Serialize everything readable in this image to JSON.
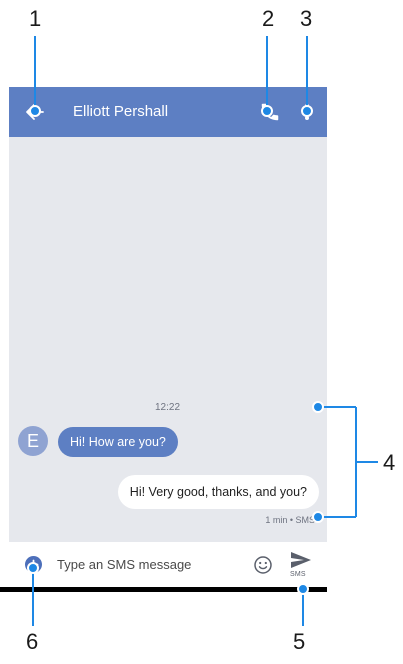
{
  "callouts": {
    "n1": "1",
    "n2": "2",
    "n3": "3",
    "n4": "4",
    "n5": "5",
    "n6": "6"
  },
  "appbar": {
    "back_icon": "arrow-left-icon",
    "title": "Elliott Pershall",
    "call_icon": "phone-icon",
    "menu_icon": "more-vert-icon",
    "color": "#5d7fc3"
  },
  "conversation": {
    "timestamp": "12:22",
    "contact_initial": "E",
    "incoming_message": "Hi! How are you?",
    "outgoing_message": "Hi! Very good, thanks, and you?",
    "outgoing_meta": "1 min • SMS",
    "background": "#e6e8ed"
  },
  "composer": {
    "add_icon": "plus-circle-icon",
    "placeholder": "Type an SMS message",
    "emoji_icon": "smiley-icon",
    "send_icon": "send-icon",
    "send_label": "SMS"
  },
  "accent": "#1e88e5"
}
